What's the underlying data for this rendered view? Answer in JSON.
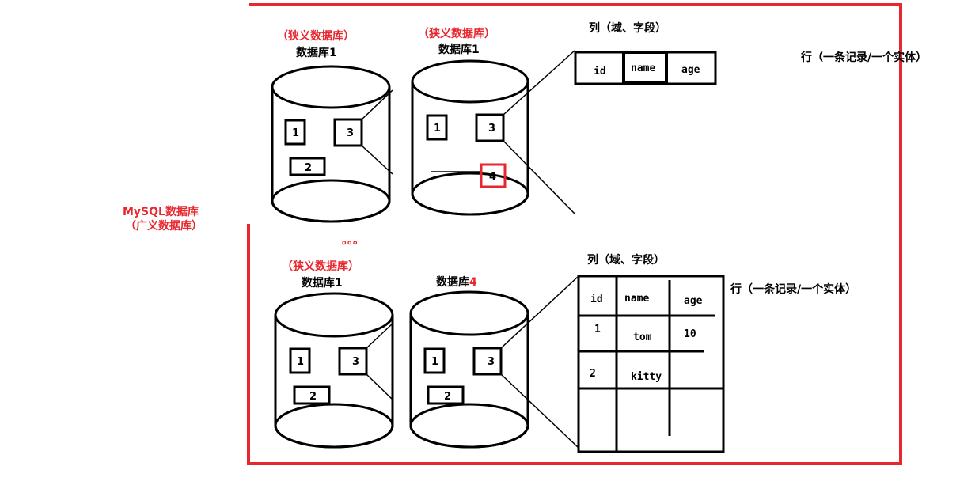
{
  "colors": {
    "accent": "#e8262d",
    "ink": "#000000",
    "background": "#ffffff"
  },
  "mysql": {
    "line1": "MySQL数据库",
    "line2": "（广义数据库）"
  },
  "ellipsis": "。。。",
  "top_left_db": {
    "tag": "（狭义数据库）",
    "name": "数据库1",
    "tables": [
      "1",
      "3",
      "2"
    ]
  },
  "top_right_db": {
    "tag": "（狭义数据库）",
    "name": "数据库1",
    "tables": [
      "1",
      "3",
      "4"
    ]
  },
  "bottom_left_db": {
    "tag": "（狭义数据库）",
    "name": "数据库1",
    "tables": [
      "1",
      "3",
      "2"
    ]
  },
  "bottom_right_db": {
    "name_prefix": "数据库",
    "name_number": "4",
    "tables": [
      "1",
      "3",
      "2"
    ]
  },
  "top_table": {
    "columns_label": "列（域、字段）",
    "row_label": "行（一条记录/一个实体）",
    "headers": [
      "id",
      "name",
      "age"
    ]
  },
  "bottom_table": {
    "columns_label": "列（域、字段）",
    "row_label": "行（一条记录/一个实体）",
    "headers": [
      "id",
      "name",
      "age"
    ],
    "rows": [
      {
        "id": "1",
        "name": "tom",
        "age": "10"
      },
      {
        "id": "2",
        "name": "kitty",
        "age": ""
      }
    ]
  }
}
